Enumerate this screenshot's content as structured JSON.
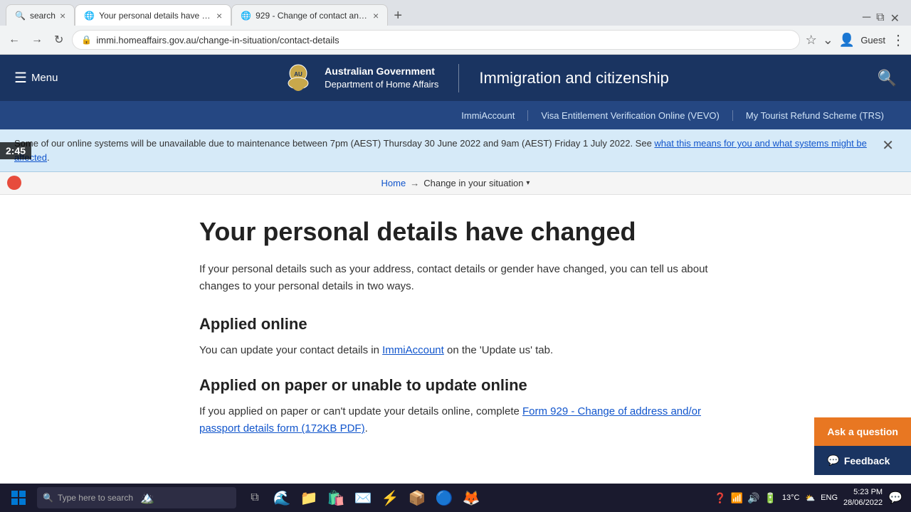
{
  "browser": {
    "tabs": [
      {
        "id": "tab1",
        "label": "search",
        "favicon": "🔍",
        "active": false
      },
      {
        "id": "tab2",
        "label": "Your personal details have chan...",
        "favicon": "🌐",
        "active": true
      },
      {
        "id": "tab3",
        "label": "929 - Change of contact and/or...",
        "favicon": "🌐",
        "active": false
      }
    ],
    "address": "immi.homeaffairs.gov.au/change-in-situation/contact-details",
    "user": "Guest"
  },
  "header": {
    "menu_label": "Menu",
    "gov_line1": "Australian Government",
    "gov_line2": "Department of Home Affairs",
    "site_title": "Immigration and citizenship"
  },
  "secondary_nav": {
    "links": [
      {
        "label": "ImmiAccount",
        "href": "#"
      },
      {
        "label": "Visa Entitlement Verification Online (VEVO)",
        "href": "#"
      },
      {
        "label": "My Tourist Refund Scheme (TRS)",
        "href": "#"
      }
    ]
  },
  "alert": {
    "text_before_link": "Some of our online systems will be unavailable due to maintenance between 7pm (AEST) Thursday 30 June 2022 and 9am (AEST) Friday 1 July 2022. See ",
    "link_text": "what this means for you and what systems might be affected",
    "text_after_link": "."
  },
  "breadcrumb": {
    "home": "Home",
    "current": "Change in your situation"
  },
  "main": {
    "heading": "Your personal details have changed",
    "intro": "If your personal details such as your address, contact details or gender have changed, you can tell us about changes to your personal details in two ways.",
    "section1_heading": "Applied online",
    "section1_text_before": "You can update your contact details in ",
    "section1_link": "ImmiAccount",
    "section1_text_after": " on the 'Update us' tab.",
    "section2_heading": "Applied on paper or unable to update online",
    "section2_text_before": "If you applied on paper or can't update your details online, complete ",
    "section2_link": "Form 929 - Change of address and/or passport details form (172KB PDF)",
    "section2_text_after": "."
  },
  "float_buttons": {
    "ask_label": "Ask a question",
    "feedback_label": "Feedback"
  },
  "timer": {
    "time": "2:45"
  },
  "taskbar": {
    "search_placeholder": "Type here to search",
    "time": "5:23 PM",
    "date": "28/06/2022",
    "language": "ENG",
    "temperature": "13°C"
  }
}
